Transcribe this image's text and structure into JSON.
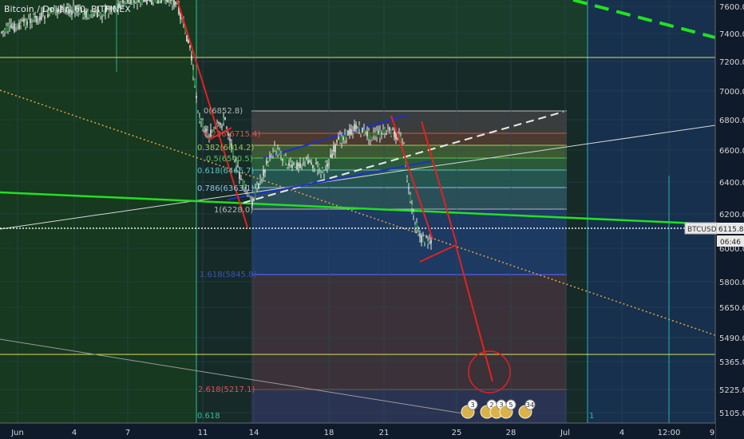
{
  "chart_data": {
    "type": "candlestick",
    "title": "Bitcoin / Dollar, 60, BITFINEX",
    "y_ticks": [
      7600,
      7400,
      7200,
      7000,
      6800,
      6600,
      6400,
      6200,
      6000,
      5800,
      5650,
      5490,
      5365,
      5225,
      5105
    ],
    "y_tick_labels": [
      "7600.0",
      "7400.0",
      "7200.0",
      "7000.0",
      "6800.0",
      "6600.0",
      "6400.0",
      "6200.0",
      "6000.0",
      "5800.0",
      "5650.0",
      "5490.0",
      "5365.0",
      "5225.0",
      "5105.0"
    ],
    "x_ticks": [
      "Jun",
      "4",
      "7",
      "11",
      "14",
      "18",
      "21",
      "25",
      "28",
      "Jul",
      "4",
      "12:00",
      "9"
    ],
    "price_label": "BTCUSD",
    "last_price": "6115.8",
    "countdown": "06:46",
    "fib_levels": [
      {
        "label": "0(6852.8)",
        "color": "#b8b8b8"
      },
      {
        "label": "0.236(6715.4)",
        "color": "#e05050"
      },
      {
        "label": "0.382(6614.2)",
        "color": "#a6c850"
      },
      {
        "label": "0.5(6540.5)",
        "color": "#5ac35a"
      },
      {
        "label": "0.618(6466.7)",
        "color": "#5ac3c3"
      },
      {
        "label": "0.786(6363.1)",
        "color": "#8fc4e8"
      },
      {
        "label": "1(6228.0)",
        "color": "#b8b8b8"
      },
      {
        "label": "1.618(5845.8)",
        "color": "#3f51b5"
      },
      {
        "label": "2.618(5217.1)",
        "color": "#e05050"
      }
    ],
    "left_fib_label": "0.618",
    "right_fib_label": "1",
    "event_badges": [
      "3",
      "2",
      "3",
      "5",
      "34"
    ],
    "colors": {
      "background": "#0f1a2b",
      "candle_up": "#e6e6e6",
      "candle_down": "#e6e6e6",
      "highlight_green": "#22e022",
      "projection_red": "#e52020",
      "channel_blue": "#2030c0",
      "yellow_line": "#e0e060",
      "orange_dotted": "#e6a040"
    }
  }
}
